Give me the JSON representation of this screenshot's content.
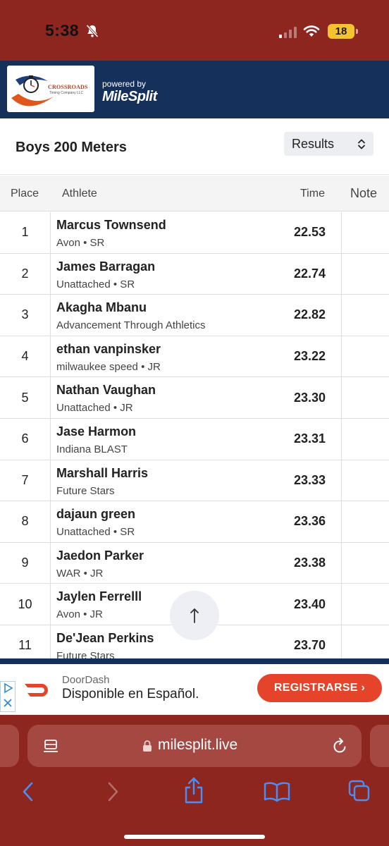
{
  "status_bar": {
    "time": "5:38",
    "battery": "18"
  },
  "brand": {
    "logo_name": "CROSSROADS",
    "logo_tagline": "Timing Company LLC",
    "powered_by": "powered by",
    "platform": "MileSplit"
  },
  "event": {
    "title": "Boys 200 Meters",
    "view_select": "Results"
  },
  "table": {
    "headers": {
      "place": "Place",
      "athlete": "Athlete",
      "time": "Time",
      "note": "Note"
    },
    "rows": [
      {
        "place": "1",
        "name": "Marcus Townsend",
        "team": "Avon • SR",
        "time": "22.53"
      },
      {
        "place": "2",
        "name": "James Barragan",
        "team": "Unattached • SR",
        "time": "22.74"
      },
      {
        "place": "3",
        "name": "Akagha Mbanu",
        "team": "Advancement Through Athletics",
        "time": "22.82"
      },
      {
        "place": "4",
        "name": "ethan vanpinsker",
        "team": "milwaukee speed • JR",
        "time": "23.22"
      },
      {
        "place": "5",
        "name": "Nathan Vaughan",
        "team": "Unattached • JR",
        "time": "23.30"
      },
      {
        "place": "6",
        "name": "Jase Harmon",
        "team": "Indiana BLAST",
        "time": "23.31"
      },
      {
        "place": "7",
        "name": "Marshall Harris",
        "team": "Future Stars",
        "time": "23.33"
      },
      {
        "place": "8",
        "name": "dajaun green",
        "team": "Unattached • SR",
        "time": "23.36"
      },
      {
        "place": "9",
        "name": "Jaedon Parker",
        "team": "WAR • JR",
        "time": "23.38"
      },
      {
        "place": "10",
        "name": "Jaylen Ferrelll",
        "team": "Avon • JR",
        "time": "23.40"
      },
      {
        "place": "11",
        "name": "De'Jean Perkins",
        "team": "Future Stars",
        "time": "23.70"
      }
    ]
  },
  "ad": {
    "brand": "DoorDash",
    "headline": "Disponible en Español.",
    "cta": "REGISTRARSE ›"
  },
  "browser": {
    "url": "milesplit.live"
  },
  "colors": {
    "brand_red": "#8e2620",
    "navy": "#14305b",
    "doordash_red": "#e5432a",
    "battery_yellow": "#f4c430"
  }
}
